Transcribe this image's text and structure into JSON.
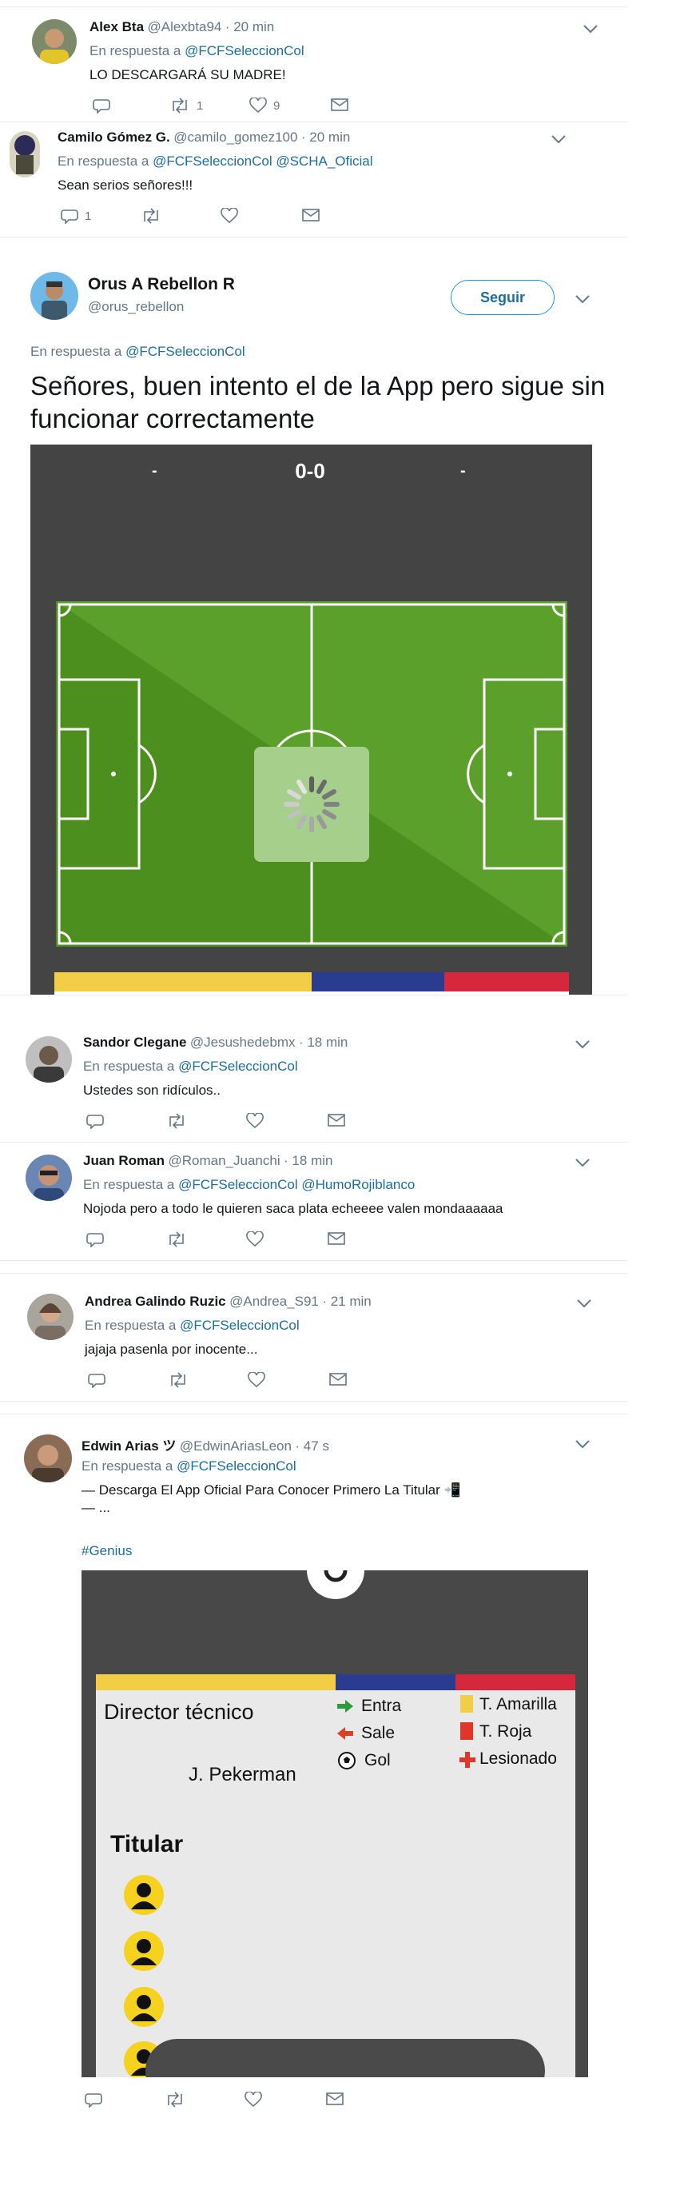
{
  "tweets": [
    {
      "name": "Alex Bta",
      "handle": "@Alexbta94",
      "time": "· 20 min",
      "reply_prefix": "En respuesta a",
      "reply_to": "@FCFSeleccionCol",
      "text": "LO DESCARGARÁ SU MADRE!",
      "retweets": "1",
      "likes": "9",
      "replies": ""
    },
    {
      "name": "Camilo Gómez G.",
      "handle": "@camilo_gomez100",
      "time": "· 20 min",
      "reply_prefix": "En respuesta a",
      "reply_to": "@FCFSeleccionCol @SCHA_Oficial",
      "text": "Sean serios señores!!!",
      "replies": "1",
      "retweets": "",
      "likes": ""
    },
    {
      "name": "Orus A Rebellon R",
      "handle": "@orus_rebellon",
      "follow_label": "Seguir",
      "reply_prefix": "En respuesta a",
      "reply_to": "@FCFSeleccionCol",
      "text": "Señores, buen intento el de la App pero sigue sin funcionar correctamente",
      "media": {
        "score": "0-0",
        "team_left": "-",
        "team_right": "-"
      }
    },
    {
      "name": "Sandor Clegane",
      "handle": "@Jesushedebmx",
      "time": "· 18 min",
      "reply_prefix": "En respuesta a",
      "reply_to": "@FCFSeleccionCol",
      "text": "Ustedes son ridículos.."
    },
    {
      "name": "Juan Roman",
      "handle": "@Roman_Juanchi",
      "time": "· 18 min",
      "reply_prefix": "En respuesta a",
      "reply_to": "@FCFSeleccionCol @HumoRojiblanco",
      "text": "Nojoda pero a todo le quieren saca plata echeeee valen mondaaaaaa"
    },
    {
      "name": "Andrea Galindo Ruzic",
      "handle": "@Andrea_S91",
      "time": "· 21 min",
      "reply_prefix": "En respuesta a",
      "reply_to": "@FCFSeleccionCol",
      "text": "jajaja pasenla por inocente..."
    },
    {
      "name": "Edwin Arias ツ",
      "handle": "@EdwinAriasLeon",
      "time": "· 47 s",
      "reply_prefix": "En respuesta a",
      "reply_to": "@FCFSeleccionCol",
      "text_line1": "— Descarga El App Oficial Para Conocer Primero La Titular 📲",
      "text_line2": "— ...",
      "hashtag": "#Genius",
      "media": {
        "director_label": "Director técnico",
        "director_name": "J. Pekerman",
        "legend": [
          "Entra",
          "Sale",
          "Gol",
          "T. Amarilla",
          "T. Roja",
          "Lesionado"
        ],
        "lineup_label": "Titular"
      }
    }
  ],
  "colors": {
    "link": "#1b6e9e",
    "muted": "#657786",
    "yellow": "#f2cd46",
    "blue": "#2a3c8f",
    "red": "#d6283c"
  }
}
